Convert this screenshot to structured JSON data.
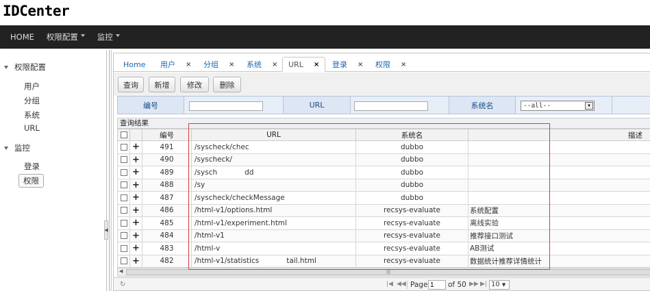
{
  "app_title": "IDCenter",
  "navbar": {
    "items": [
      {
        "label": "HOME",
        "has_caret": false
      },
      {
        "label": "权限配置",
        "has_caret": true
      },
      {
        "label": "监控",
        "has_caret": true
      }
    ]
  },
  "sidebar": {
    "groups": [
      {
        "label": "权限配置",
        "items": [
          "用户",
          "分组",
          "系统",
          "URL"
        ]
      },
      {
        "label": "监控",
        "items": [
          "登录",
          "权限"
        ]
      }
    ],
    "selected_item": "权限"
  },
  "tabs": [
    {
      "label": "Home",
      "closable": false
    },
    {
      "label": "用户",
      "closable": true
    },
    {
      "label": "分组",
      "closable": true
    },
    {
      "label": "系统",
      "closable": true
    },
    {
      "label": "URL",
      "closable": true,
      "active": true
    },
    {
      "label": "登录",
      "closable": true
    },
    {
      "label": "权限",
      "closable": true
    }
  ],
  "close_glyph": "×",
  "toolbar": {
    "query": "查询",
    "add": "新增",
    "edit": "修改",
    "delete": "删除"
  },
  "filter": {
    "id_label": "编号",
    "url_label": "URL",
    "system_label": "系统名",
    "system_value": "--all--"
  },
  "grid": {
    "title": "查询结果",
    "columns": {
      "id": "编号",
      "url": "URL",
      "system": "系统名",
      "desc": "描述"
    },
    "rows": [
      {
        "id": "491",
        "url": "/syscheck/chec",
        "system": "dubbo",
        "desc": ""
      },
      {
        "id": "490",
        "url": "/syscheck/",
        "system": "dubbo",
        "desc": ""
      },
      {
        "id": "489",
        "url": "/sysch",
        "url_tail": "dd",
        "system": "dubbo",
        "desc": ""
      },
      {
        "id": "488",
        "url": "/sy",
        "system": "dubbo",
        "desc": ""
      },
      {
        "id": "487",
        "url": "/syscheck/checkMessage",
        "system": "dubbo",
        "desc": ""
      },
      {
        "id": "486",
        "url": "/html-v1/options.html",
        "system": "recsys-evaluate",
        "desc": "系统配置"
      },
      {
        "id": "485",
        "url": "/html-v1/experiment.html",
        "system": "recsys-evaluate",
        "desc": "离线实验"
      },
      {
        "id": "484",
        "url": "/html-v1",
        "system": "recsys-evaluate",
        "desc": "推荐接口测试"
      },
      {
        "id": "483",
        "url": "/html-v",
        "system": "recsys-evaluate",
        "desc": "AB测试"
      },
      {
        "id": "482",
        "url": "/html-v1/statistics",
        "url_tail": "tail.html",
        "system": "recsys-evaluate",
        "desc": "数据统计推荐详情统计"
      }
    ]
  },
  "pager": {
    "page_label": "Page",
    "page_value": "1",
    "of_label": "of 50",
    "page_size": "10"
  },
  "colors": {
    "annotation_box": "#d43c3c",
    "navbar": "#222222",
    "link": "#1b66b1"
  }
}
